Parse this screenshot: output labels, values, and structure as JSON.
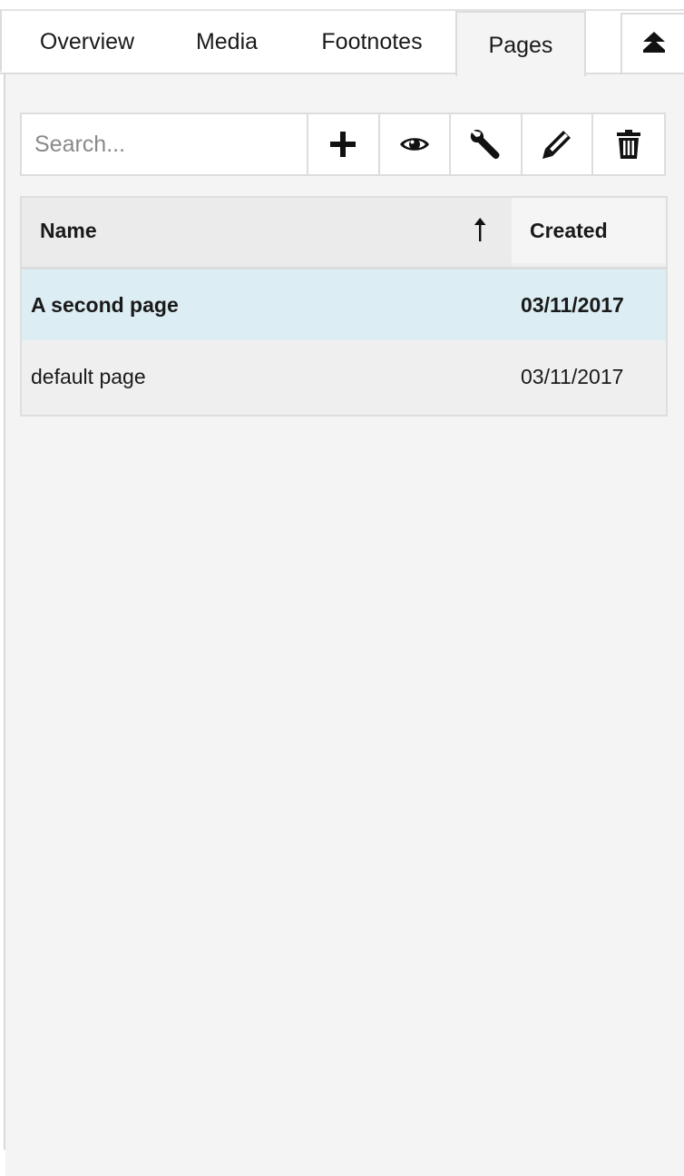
{
  "tabs": [
    {
      "label": "Overview"
    },
    {
      "label": "Media"
    },
    {
      "label": "Footnotes"
    },
    {
      "label": "Pages",
      "active": true
    }
  ],
  "collapse_button": {
    "icon": "eject-double-chevron-up-icon"
  },
  "toolbar": {
    "search_placeholder": "Search...",
    "search_value": "",
    "buttons": [
      {
        "name": "add",
        "icon": "plus-icon"
      },
      {
        "name": "view",
        "icon": "eye-icon"
      },
      {
        "name": "settings",
        "icon": "wrench-icon"
      },
      {
        "name": "edit",
        "icon": "pencil-icon"
      },
      {
        "name": "delete",
        "icon": "trash-icon"
      }
    ]
  },
  "table": {
    "columns": [
      {
        "label": "Name",
        "sort": "ascending",
        "sort_icon": "arrow-up-icon"
      },
      {
        "label": "Created"
      }
    ],
    "rows": [
      {
        "name": "A second page",
        "created": "03/11/2017",
        "selected": true
      },
      {
        "name": "default page",
        "created": "03/11/2017",
        "selected": false
      }
    ]
  },
  "colors": {
    "selected_row": "#dcedf3",
    "panel_bg": "#f4f4f4",
    "border": "#dddddd"
  }
}
